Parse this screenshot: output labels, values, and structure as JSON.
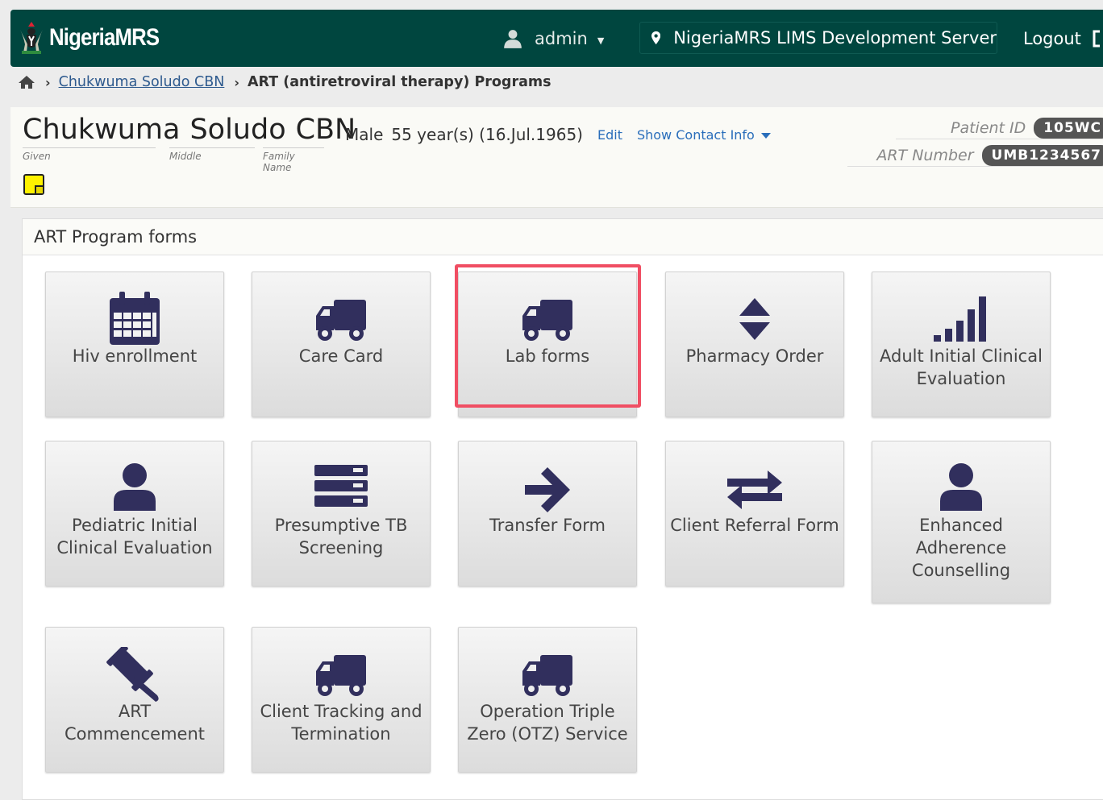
{
  "header": {
    "logo_text": "NigeriaMRS",
    "user": "admin",
    "location": "NigeriaMRS LIMS Development Server",
    "logout": "Logout"
  },
  "breadcrumb": {
    "patient_link": "Chukwuma Soludo CBN",
    "current": "ART (antiretroviral therapy) Programs"
  },
  "patient": {
    "given": "Chukwuma",
    "middle": "Soludo",
    "family": "CBN",
    "given_label": "Given",
    "middle_label": "Middle",
    "family_label": "Family Name",
    "gender": "Male",
    "age": "55 year(s) (16.Jul.1965)",
    "edit": "Edit",
    "show_contact": "Show Contact Info",
    "patient_id_label": "Patient ID",
    "patient_id": "105WC",
    "art_number_label": "ART Number",
    "art_number": "UMB1234567"
  },
  "panel": {
    "title": "ART Program forms",
    "tiles": [
      {
        "label": "Hiv enrollment",
        "icon": "calendar-icon"
      },
      {
        "label": "Care Card",
        "icon": "truck-icon"
      },
      {
        "label": "Lab forms",
        "icon": "truck-icon",
        "highlighted": true
      },
      {
        "label": "Pharmacy Order",
        "icon": "sort-icon"
      },
      {
        "label": "Adult Initial Clinical Evaluation",
        "icon": "signal-icon"
      },
      {
        "label": "Pediatric Initial Clinical Evaluation",
        "icon": "user-icon"
      },
      {
        "label": "Presumptive TB Screening",
        "icon": "server-icon"
      },
      {
        "label": "Transfer Form",
        "icon": "arrow-right-icon"
      },
      {
        "label": "Client Referral Form",
        "icon": "exchange-icon"
      },
      {
        "label": "Enhanced Adherence Counselling",
        "icon": "user-icon"
      },
      {
        "label": "ART Commencement",
        "icon": "gavel-icon"
      },
      {
        "label": "Client Tracking and Termination",
        "icon": "truck-icon"
      },
      {
        "label": "Operation Triple Zero (OTZ) Service",
        "icon": "truck-icon"
      }
    ]
  },
  "colors": {
    "header_bg": "#00463f",
    "icon": "#312f5d",
    "highlight": "#f04e63",
    "link": "#2a6ebb"
  }
}
